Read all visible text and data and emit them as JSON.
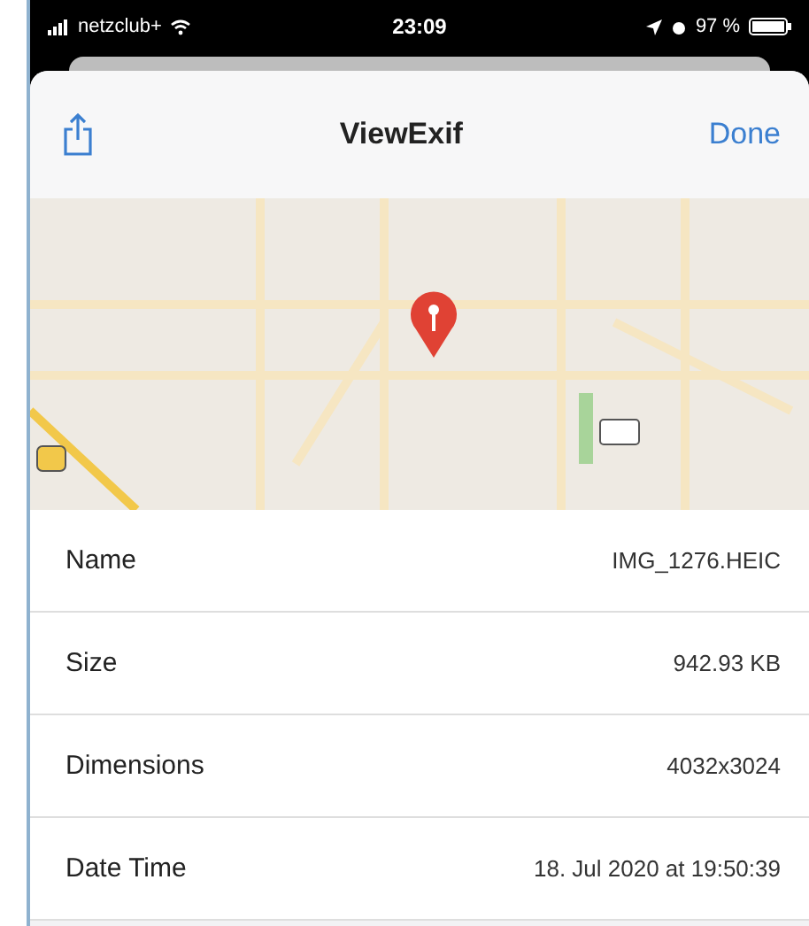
{
  "status_bar": {
    "carrier": "netzclub+",
    "time": "23:09",
    "battery": "97 %"
  },
  "nav_bar": {
    "title": "ViewExif",
    "done": "Done"
  },
  "rows": [
    {
      "label": "Name",
      "value": "IMG_1276.HEIC"
    },
    {
      "label": "Size",
      "value": "942.93 KB"
    },
    {
      "label": "Dimensions",
      "value": "4032x3024"
    },
    {
      "label": "Date Time",
      "value": "18. Jul 2020 at 19:50:39"
    }
  ]
}
